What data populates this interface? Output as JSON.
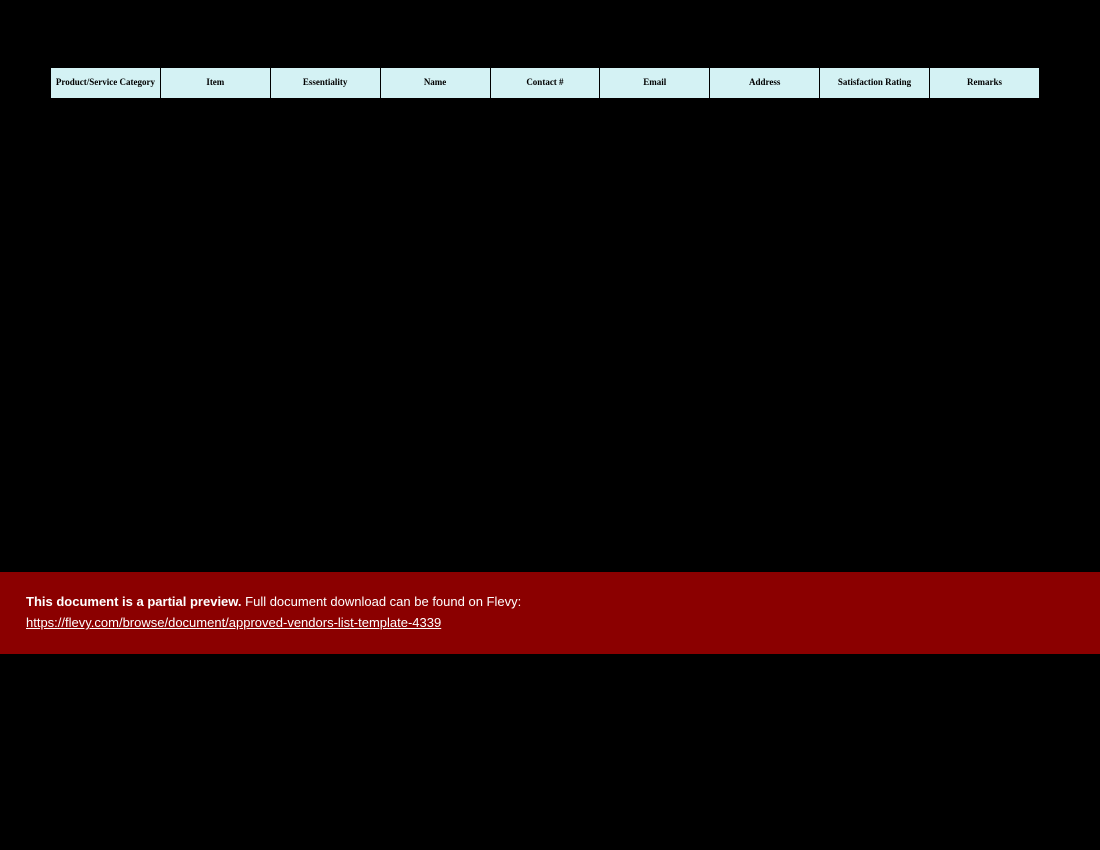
{
  "table": {
    "headers": [
      "Product/Service Category",
      "Item",
      "Essentiality",
      "Name",
      "Contact #",
      "Email",
      "Address",
      "Satisfaction Rating",
      "Remarks"
    ]
  },
  "banner": {
    "bold_text": "This document is a partial preview.",
    "rest_text": "  Full document download can be found on Flevy:",
    "link_text": "https://flevy.com/browse/document/approved-vendors-list-template-4339"
  }
}
